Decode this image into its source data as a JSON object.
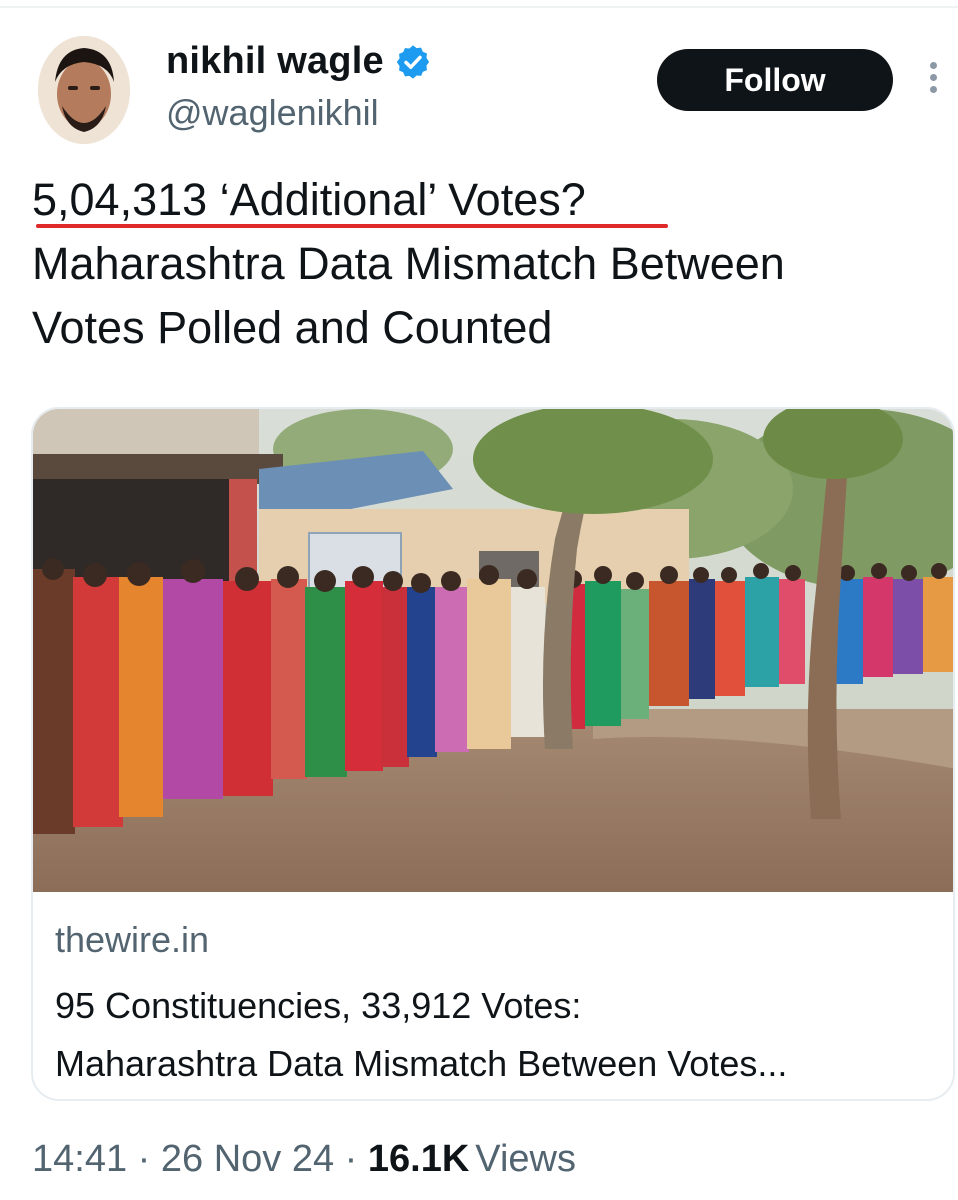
{
  "author": {
    "name": "nikhil wagle",
    "handle": "@waglenikhil",
    "verified": true,
    "verified_color": "#1d9bf0"
  },
  "actions": {
    "follow_label": "Follow",
    "more_icon": "more-vertical-icon"
  },
  "tweet": {
    "lines": [
      "5,04,313 ‘Additional’ Votes?",
      "Maharashtra Data Mismatch Between",
      "Votes Polled and Counted"
    ],
    "highlight_color": "#e0292b"
  },
  "link_card": {
    "image_alt": "women queueing outside a polling booth under trees",
    "domain": "thewire.in",
    "title_lines": [
      "95 Constituencies, 33,912 Votes:",
      "Maharashtra Data Mismatch Between Votes..."
    ]
  },
  "meta": {
    "time": "14:41",
    "separator": "·",
    "date": "26 Nov 24",
    "views_count": "16.1K",
    "views_label": "Views"
  }
}
